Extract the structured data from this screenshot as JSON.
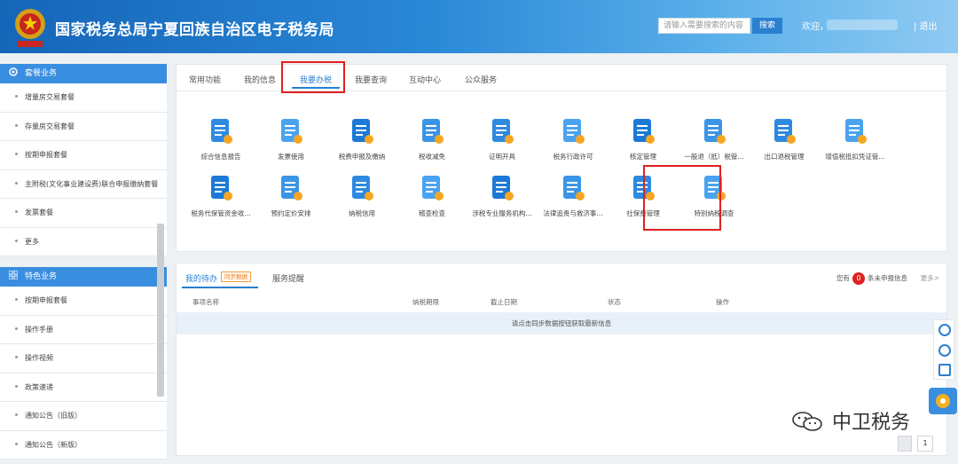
{
  "header": {
    "title": "国家税务总局宁夏回族自治区电子税务局",
    "search_placeholder": "请输入需要搜索的内容",
    "search_button": "搜索",
    "welcome": "欢迎，",
    "logout": "| 退出",
    "accent_color": "#1565b8"
  },
  "sidebar": {
    "section1_title": "套餐业务",
    "section1_items": [
      "增量房交易套餐",
      "存量房交易套餐",
      "按期申报套餐",
      "主附税(文化事业建设费)联合申报缴纳套餐",
      "发票套餐",
      "更多"
    ],
    "section2_title": "特色业务",
    "section2_items": [
      "按期申报套餐",
      "操作手册",
      "操作视频",
      "政策速递",
      "通知公告（旧版）",
      "通知公告（新版）"
    ]
  },
  "tabs": [
    "常用功能",
    "我的信息",
    "我要办税",
    "我要查询",
    "互动中心",
    "公众服务"
  ],
  "active_tab": "我要办税",
  "function_icons": [
    {
      "label": "综合信息报告",
      "icon": "report-icon"
    },
    {
      "label": "发票使用",
      "icon": "invoice-icon"
    },
    {
      "label": "税费申报及缴纳",
      "icon": "tax-declare-icon"
    },
    {
      "label": "税收减免",
      "icon": "tax-relief-icon"
    },
    {
      "label": "证明开具",
      "icon": "certificate-icon"
    },
    {
      "label": "税务行政许可",
      "icon": "license-icon"
    },
    {
      "label": "核定管理",
      "icon": "approval-icon"
    },
    {
      "label": "一般退（抵）税管...",
      "icon": "refund-icon"
    },
    {
      "label": "出口退税管理",
      "icon": "export-refund-icon"
    },
    {
      "label": "增值税抵扣凭证管...",
      "icon": "vat-voucher-icon"
    },
    {
      "label": "税务代保管资金收...",
      "icon": "custody-fund-icon"
    },
    {
      "label": "预约定价安排",
      "icon": "pricing-icon"
    },
    {
      "label": "纳税信用",
      "icon": "credit-icon"
    },
    {
      "label": "稽查检查",
      "icon": "inspection-icon"
    },
    {
      "label": "涉税专业服务机构...",
      "icon": "agency-icon"
    },
    {
      "label": "法律追责与救济事...",
      "icon": "legal-icon"
    },
    {
      "label": "社保费管理",
      "icon": "social-security-icon"
    },
    {
      "label": "特别纳税调查",
      "icon": "special-investigation-icon"
    }
  ],
  "bottom_panel": {
    "tab_todo": "我的待办",
    "todo_badge": "同步数据",
    "tab_reminder": "服务提醒",
    "notice_prefix": "您有",
    "notice_count": "0",
    "notice_suffix": "条未申报信息",
    "more": "更多>",
    "columns": [
      "事项名称",
      "纳税期限",
      "截止日期",
      "状态",
      "操作"
    ],
    "empty_message": "请点击同步数据按钮获取最新信息"
  },
  "watermark": "中卫税务",
  "pager": {
    "page": "1"
  }
}
